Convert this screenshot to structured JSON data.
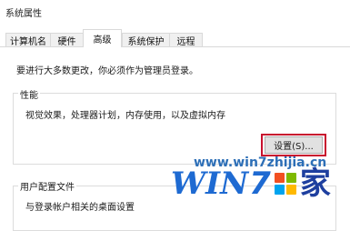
{
  "window": {
    "title": "系统属性"
  },
  "tabs": [
    {
      "label": "计算机名",
      "active": false
    },
    {
      "label": "硬件",
      "active": false
    },
    {
      "label": "高级",
      "active": true
    },
    {
      "label": "系统保护",
      "active": false
    },
    {
      "label": "远程",
      "active": false
    }
  ],
  "admin_note": "要进行大多数更改，你必须作为管理员登录。",
  "performance": {
    "label": "性能",
    "description": "视觉效果，处理器计划，内存使用，以及虚拟内存",
    "settings_button": "设置(S)..."
  },
  "user_profiles": {
    "label": "用户配置文件",
    "description": "与登录帐户相关的桌面设置"
  },
  "watermark": {
    "url": "www.win7zhijia.cn",
    "brand_win": "WIN",
    "brand_seven": "7",
    "brand_home": "家",
    "logo_colors": [
      "#f25022",
      "#7fba00",
      "#00a4ef",
      "#ffb900"
    ]
  }
}
